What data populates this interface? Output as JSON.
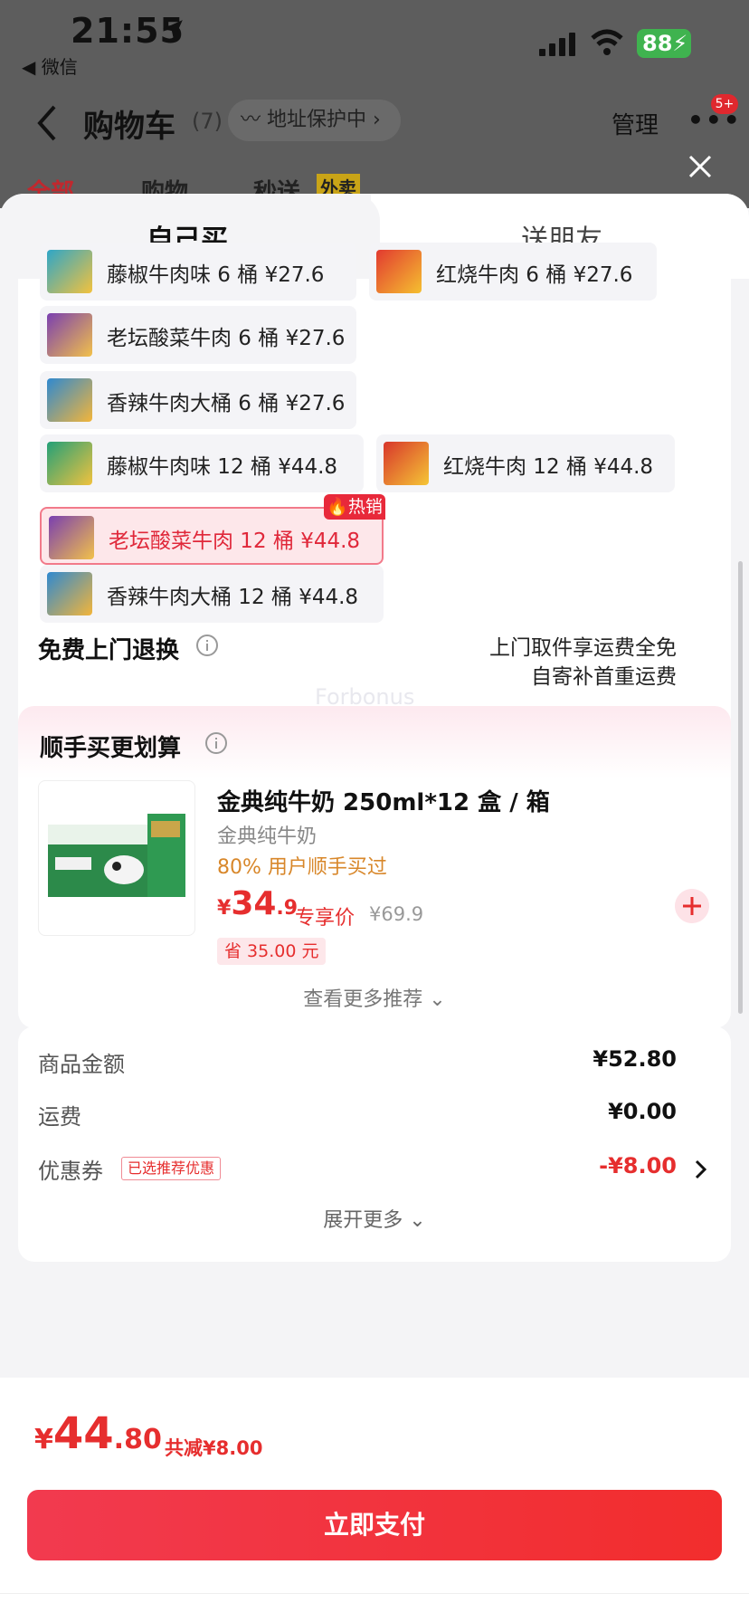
{
  "status_bar": {
    "time": "21:55",
    "back_app": "◀ 微信",
    "battery": "88"
  },
  "header": {
    "title": "购物车",
    "count": "(7)",
    "address_pill": "地址保护中 ›",
    "manage": "管理",
    "more_badge": "5+"
  },
  "bg_tabs": [
    "全部",
    "购物",
    "秒送",
    "外卖"
  ],
  "sheet_tabs": {
    "self": "自己买",
    "friend": "送朋友"
  },
  "options": [
    {
      "label": "藤椒牛肉味 6 桶   ¥27.6"
    },
    {
      "label": "红烧牛肉 6 桶   ¥27.6"
    },
    {
      "label": "老坛酸菜牛肉 6 桶   ¥27.6"
    },
    {
      "label": "香辣牛肉大桶 6 桶   ¥27.6"
    },
    {
      "label": "藤椒牛肉味 12 桶   ¥44.8"
    },
    {
      "label": "红烧牛肉 12 桶   ¥44.8"
    },
    {
      "label": "老坛酸菜牛肉 12 桶   ¥44.8",
      "tag": "热销"
    },
    {
      "label": "香辣牛肉大桶 12 桶   ¥44.8"
    }
  ],
  "returns": {
    "title": "免费上门退换",
    "line1": "上门取件享运费全免",
    "line2": "自寄补首重运费"
  },
  "watermark": "Forbonus",
  "recommend": {
    "title": "顺手买更划算",
    "product_name": "金典纯牛奶 250ml*12 盒 / 箱",
    "brand": "金典纯牛奶",
    "bought": "80% 用户顺手买过",
    "price_yen": "¥",
    "price_int": "34",
    "price_dec": ".9",
    "price_tag": "专享价",
    "orig_price": "¥69.9",
    "save": "省 35.00 元",
    "more": "查看更多推荐 ⌄"
  },
  "summary": {
    "goods_label": "商品金额",
    "goods_value": "¥52.80",
    "ship_label": "运费",
    "ship_value": "¥0.00",
    "coupon_label": "优惠券",
    "coupon_tag": "已选推荐优惠",
    "coupon_value": "-¥8.00",
    "expand": "展开更多 ⌄"
  },
  "checkout": {
    "yen": "¥",
    "int": "44",
    "dec": ".80",
    "reduce": "共减¥8.00",
    "pay": "立即支付"
  },
  "colors": {
    "accent": "#e62e2e",
    "hot": "#e8293a"
  }
}
